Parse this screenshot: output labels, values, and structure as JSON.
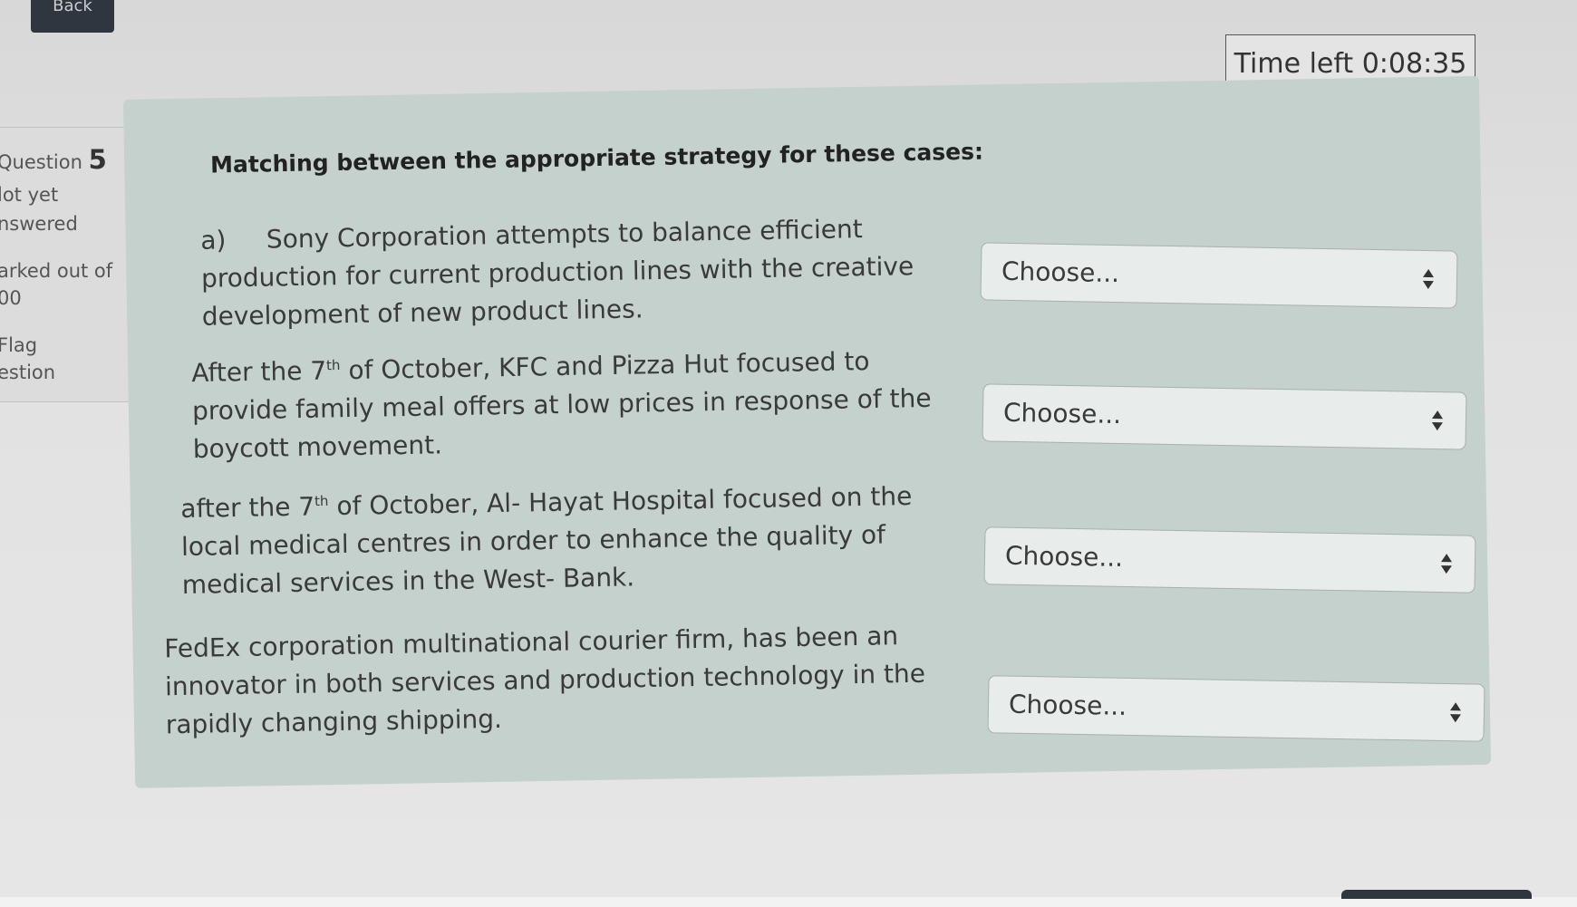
{
  "nav": {
    "back_label": "Back"
  },
  "timer": {
    "text": "Time left 0:08:35"
  },
  "question_info": {
    "question_word": "Question",
    "question_number": "5",
    "status_line1": "lot yet",
    "status_line2": "nswered",
    "marked_line1": "arked out of",
    "marked_line2": "00",
    "flag_line1": "Flag",
    "flag_line2": "estion"
  },
  "question": {
    "title": "Matching between the appropriate strategy for these cases:",
    "cases": [
      {
        "lines": [
          "a)     Sony Corporation attempts to balance efficient",
          "production for current production lines with the creative",
          "development of new product lines."
        ],
        "select_value": "Choose..."
      },
      {
        "line1_before": "After the 7",
        "line1_sup": "th",
        "line1_after": " of October, KFC and Pizza Hut focused to",
        "lines": [
          "provide family meal offers at low prices in response of the",
          "boycott movement."
        ],
        "select_value": "Choose..."
      },
      {
        "line1_before": "after the 7",
        "line1_sup": "th",
        "line1_after": " of October, Al- Hayat Hospital focused on the",
        "lines": [
          "local medical centres in order to enhance the quality of",
          "medical services in the  West- Bank."
        ],
        "select_value": "Choose..."
      },
      {
        "lines": [
          "FedEx corporation multinational courier firm, has been an",
          "innovator in both services and production technology in the",
          "rapidly changing shipping."
        ],
        "select_value": "Choose..."
      }
    ]
  },
  "icons": {
    "select_arrow": "up-down-arrows-icon"
  }
}
